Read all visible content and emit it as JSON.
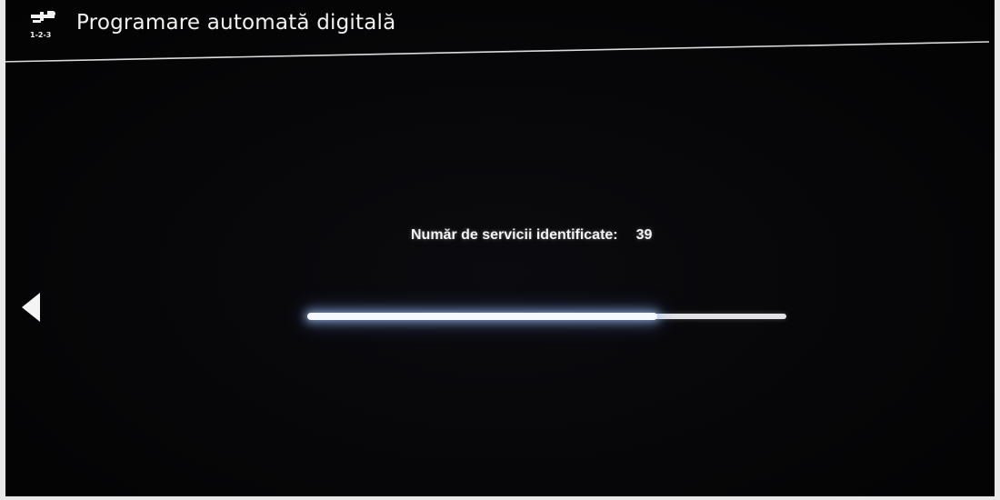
{
  "header": {
    "title": "Programare automată digitală",
    "icon": "setup-tools-icon",
    "icon_caption": "1-2-3"
  },
  "status": {
    "label": "Număr de servicii identificate:",
    "count": "39"
  },
  "progress": {
    "fraction": 0.73
  },
  "navigation": {
    "back_icon": "left-arrow-icon"
  },
  "colors": {
    "background": "#050505",
    "text": "#f2f2f2",
    "progress_track": "#e2e2e6",
    "progress_glow": "#aac8ff"
  }
}
